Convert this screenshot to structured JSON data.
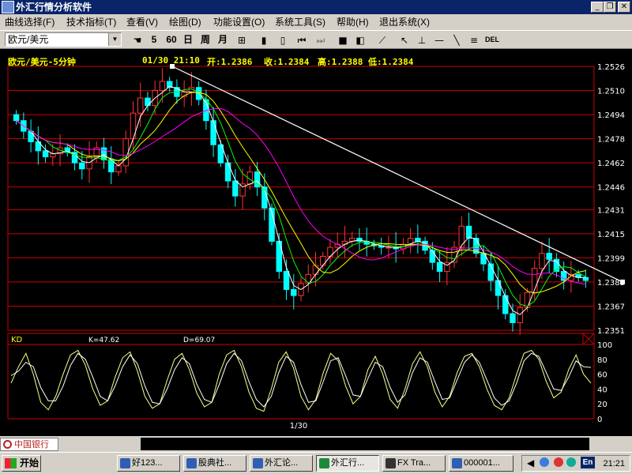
{
  "window": {
    "title": "外汇行情分析软件",
    "minimize_glyph": "_",
    "restore_glyph": "❐",
    "close_glyph": "✕"
  },
  "menu": [
    "曲线选择(F)",
    "技术指标(T)",
    "查看(V)",
    "绘图(D)",
    "功能设置(O)",
    "系统工具(S)",
    "帮助(H)",
    "退出系统(X)"
  ],
  "toolbar": {
    "symbol": "欧元/美元",
    "buttons": {
      "period_5": "5",
      "period_60": "60",
      "day": "日",
      "week": "周",
      "month": "月",
      "del": "DEL"
    }
  },
  "chart_header": {
    "name": "欧元/美元-5分钟",
    "datetime": "01/30 21:10",
    "open": "开:1.2386",
    "close": "收:1.2384",
    "high": "高:1.2388",
    "low": "低:1.2384"
  },
  "chart_data": [
    {
      "type": "candlestick",
      "title": "欧元/美元-5分钟",
      "y_ticks": [
        "1.2526",
        "1.2510",
        "1.2494",
        "1.2478",
        "1.2462",
        "1.2446",
        "1.2431",
        "1.2415",
        "1.2399",
        "1.2383",
        "1.2367",
        "1.2351"
      ],
      "ylim": [
        1.2351,
        1.2526
      ],
      "approx_closes": [
        1.249,
        1.2483,
        1.2476,
        1.247,
        1.2466,
        1.2468,
        1.2472,
        1.2469,
        1.2462,
        1.2458,
        1.2466,
        1.2472,
        1.2464,
        1.2456,
        1.246,
        1.2478,
        1.2495,
        1.2505,
        1.25,
        1.251,
        1.2516,
        1.2512,
        1.2506,
        1.2509,
        1.2512,
        1.2504,
        1.249,
        1.2474,
        1.2462,
        1.245,
        1.244,
        1.2448,
        1.2456,
        1.2446,
        1.2432,
        1.241,
        1.239,
        1.2378,
        1.2374,
        1.2382,
        1.2388,
        1.2394,
        1.24,
        1.2406,
        1.2408,
        1.241,
        1.2412,
        1.241,
        1.2408,
        1.2407,
        1.2406,
        1.2406,
        1.2405,
        1.2408,
        1.2412,
        1.241,
        1.2404,
        1.2396,
        1.239,
        1.2396,
        1.2406,
        1.242,
        1.2412,
        1.2402,
        1.2395,
        1.2384,
        1.2374,
        1.2362,
        1.2356,
        1.2366,
        1.2376,
        1.2392,
        1.2402,
        1.2398,
        1.239,
        1.2384,
        1.2388,
        1.2386,
        1.2384
      ],
      "moving_averages": [
        {
          "color": "#ffffff"
        },
        {
          "color": "#00ff00"
        },
        {
          "color": "#ffff00"
        },
        {
          "color": "#ff00ff"
        }
      ],
      "trendline": {
        "from": 1.2526,
        "to": 1.2383,
        "color": "#ffffff"
      },
      "x_label": "1/30"
    },
    {
      "type": "line",
      "title": "KD",
      "k_label": "K=47.62",
      "d_label": "D=69.07",
      "y_ticks": [
        "100",
        "80",
        "60",
        "40",
        "20",
        "0"
      ],
      "ylim": [
        0,
        100
      ],
      "series": [
        {
          "name": "K",
          "color": "#ffff80",
          "values": [
            48,
            70,
            88,
            60,
            22,
            12,
            30,
            60,
            86,
            92,
            72,
            40,
            18,
            24,
            56,
            82,
            90,
            64,
            30,
            14,
            20,
            52,
            80,
            88,
            66,
            34,
            16,
            22,
            60,
            86,
            92,
            70,
            36,
            14,
            10,
            40,
            76,
            90,
            68,
            30,
            12,
            26,
            62,
            88,
            78,
            44,
            20,
            30,
            66,
            84,
            60,
            26,
            14,
            40,
            74,
            90,
            70,
            36,
            16,
            30,
            62,
            84,
            88,
            70,
            40,
            18,
            12,
            28,
            60,
            88,
            92,
            80,
            50,
            28,
            36,
            66,
            86,
            60,
            48
          ]
        },
        {
          "name": "D",
          "color": "#ffffff",
          "values": [
            58,
            64,
            76,
            70,
            42,
            24,
            24,
            44,
            72,
            88,
            80,
            56,
            30,
            24,
            44,
            70,
            86,
            74,
            44,
            22,
            20,
            40,
            66,
            82,
            74,
            46,
            26,
            22,
            46,
            74,
            88,
            78,
            50,
            26,
            16,
            30,
            62,
            84,
            76,
            46,
            22,
            24,
            50,
            78,
            82,
            58,
            32,
            30,
            54,
            76,
            70,
            42,
            22,
            32,
            62,
            82,
            76,
            50,
            26,
            28,
            52,
            76,
            86,
            76,
            52,
            28,
            18,
            24,
            48,
            78,
            88,
            84,
            62,
            40,
            38,
            56,
            78,
            70,
            69
          ]
        }
      ]
    }
  ],
  "taskbar": {
    "start": "开始",
    "tasks": [
      "好123...",
      "股典社...",
      "外汇论...",
      "外汇行...",
      "FX Tra...",
      "000001..."
    ],
    "clock": "21:21",
    "lang": "En"
  },
  "status_logo": "中国银行",
  "icons": [
    "app-icon",
    "hand-icon",
    "grid-icon",
    "cursor-icon",
    "crosshair-icon",
    "line-icon"
  ],
  "colors": {
    "background": "#000000",
    "grid": "#cc0000",
    "up": "#ff3333",
    "down": "#00ffff",
    "header": "#ffff00",
    "axis_label": "#ffffff"
  }
}
